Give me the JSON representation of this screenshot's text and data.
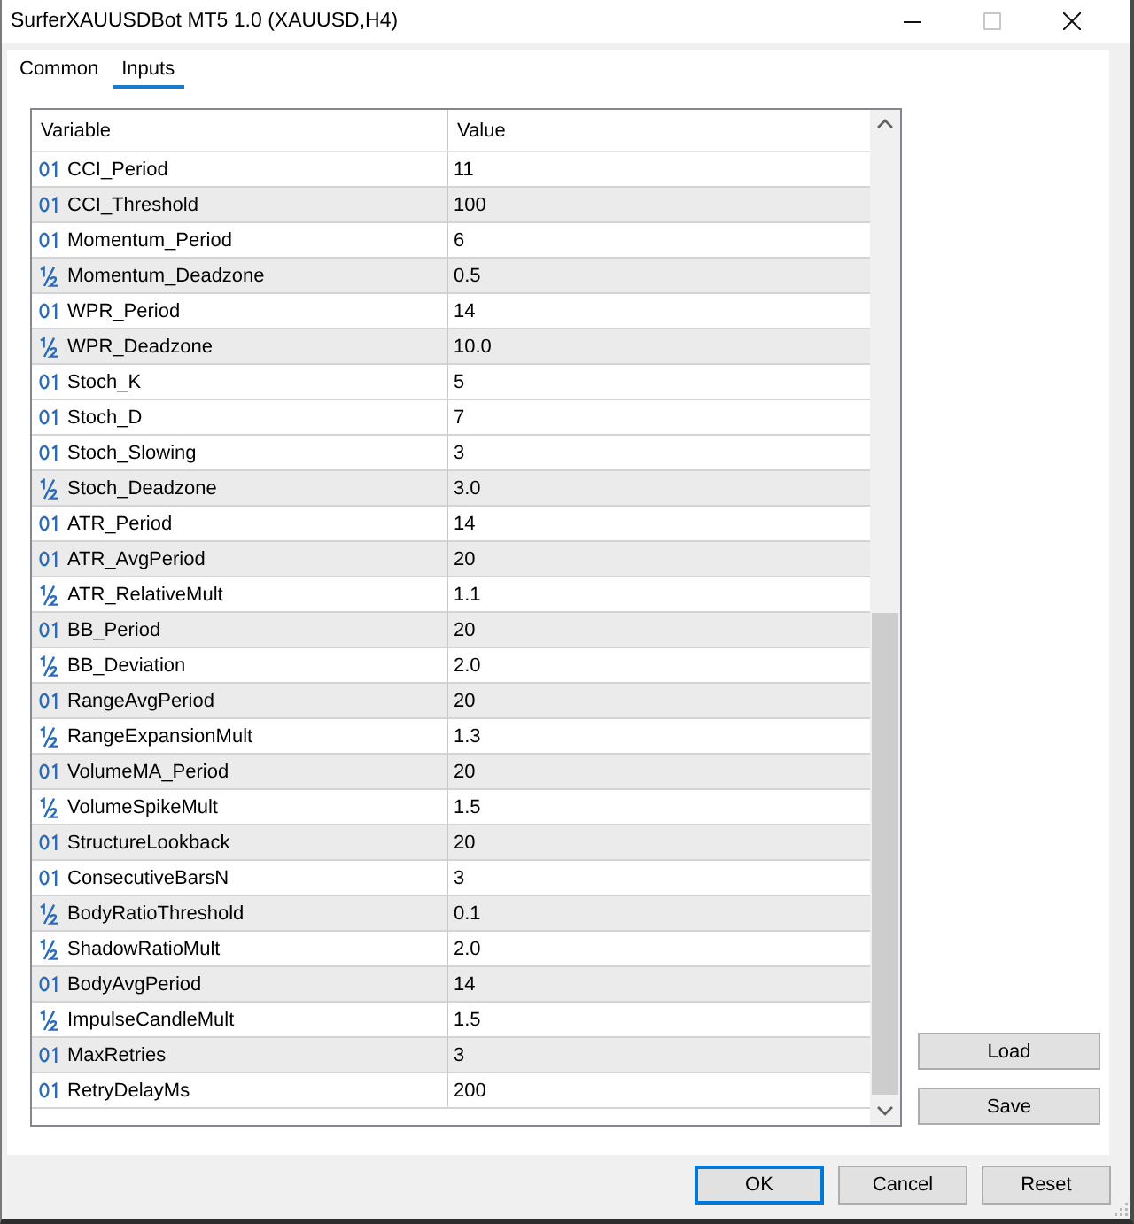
{
  "window": {
    "title": "SurferXAUUSDBot MT5 1.0 (XAUUSD,H4)",
    "controls": [
      {
        "kind": "minimize",
        "disabled": false
      },
      {
        "kind": "maximize",
        "disabled": true
      },
      {
        "kind": "close",
        "disabled": false
      }
    ]
  },
  "tabs": [
    {
      "label": "Common",
      "selected": false
    },
    {
      "label": "Inputs",
      "selected": true
    }
  ],
  "table": {
    "columns": [
      "Variable",
      "Value"
    ],
    "rows": [
      {
        "kind": "integer",
        "variable": "CCI_Period",
        "value": "11",
        "shaded": false
      },
      {
        "kind": "integer",
        "variable": "CCI_Threshold",
        "value": "100",
        "shaded": true
      },
      {
        "kind": "integer",
        "variable": "Momentum_Period",
        "value": "6",
        "shaded": false
      },
      {
        "kind": "double",
        "variable": "Momentum_Deadzone",
        "value": "0.5",
        "shaded": true
      },
      {
        "kind": "integer",
        "variable": "WPR_Period",
        "value": "14",
        "shaded": false
      },
      {
        "kind": "double",
        "variable": "WPR_Deadzone",
        "value": "10.0",
        "shaded": true
      },
      {
        "kind": "integer",
        "variable": "Stoch_K",
        "value": "5",
        "shaded": false
      },
      {
        "kind": "integer",
        "variable": "Stoch_D",
        "value": "7",
        "shaded": false
      },
      {
        "kind": "integer",
        "variable": "Stoch_Slowing",
        "value": "3",
        "shaded": false
      },
      {
        "kind": "double",
        "variable": "Stoch_Deadzone",
        "value": "3.0",
        "shaded": true
      },
      {
        "kind": "integer",
        "variable": "ATR_Period",
        "value": "14",
        "shaded": false
      },
      {
        "kind": "integer",
        "variable": "ATR_AvgPeriod",
        "value": "20",
        "shaded": true
      },
      {
        "kind": "double",
        "variable": "ATR_RelativeMult",
        "value": "1.1",
        "shaded": false
      },
      {
        "kind": "integer",
        "variable": "BB_Period",
        "value": "20",
        "shaded": true
      },
      {
        "kind": "double",
        "variable": "BB_Deviation",
        "value": "2.0",
        "shaded": false
      },
      {
        "kind": "integer",
        "variable": "RangeAvgPeriod",
        "value": "20",
        "shaded": true
      },
      {
        "kind": "double",
        "variable": "RangeExpansionMult",
        "value": "1.3",
        "shaded": false
      },
      {
        "kind": "integer",
        "variable": "VolumeMA_Period",
        "value": "20",
        "shaded": true
      },
      {
        "kind": "double",
        "variable": "VolumeSpikeMult",
        "value": "1.5",
        "shaded": false
      },
      {
        "kind": "integer",
        "variable": "StructureLookback",
        "value": "20",
        "shaded": true
      },
      {
        "kind": "integer",
        "variable": "ConsecutiveBarsN",
        "value": "3",
        "shaded": false
      },
      {
        "kind": "double",
        "variable": "BodyRatioThreshold",
        "value": "0.1",
        "shaded": true
      },
      {
        "kind": "double",
        "variable": "ShadowRatioMult",
        "value": "2.0",
        "shaded": false
      },
      {
        "kind": "integer",
        "variable": "BodyAvgPeriod",
        "value": "14",
        "shaded": true
      },
      {
        "kind": "double",
        "variable": "ImpulseCandleMult",
        "value": "1.5",
        "shaded": false
      },
      {
        "kind": "integer",
        "variable": "MaxRetries",
        "value": "3",
        "shaded": true
      },
      {
        "kind": "integer",
        "variable": "RetryDelayMs",
        "value": "200",
        "shaded": false
      }
    ]
  },
  "side_buttons": [
    "Load",
    "Save"
  ],
  "buttons": [
    {
      "label": "OK",
      "default": true
    },
    {
      "label": "Cancel",
      "default": false
    },
    {
      "label": "Reset",
      "default": false
    }
  ]
}
